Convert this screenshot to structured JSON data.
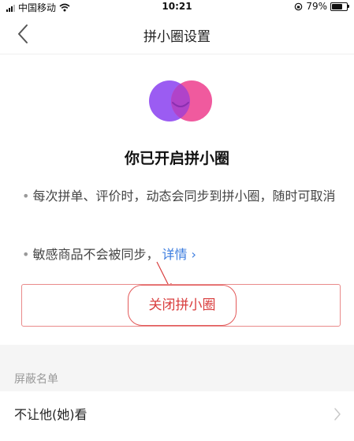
{
  "status_bar": {
    "carrier": "中国移动",
    "time": "10:21",
    "battery_percent": "79%",
    "battery_level": 0.79
  },
  "nav": {
    "title": "拼小圈设置"
  },
  "hero": {
    "title": "你已开启拼小圈",
    "logo_colors": [
      "#9b5cf2",
      "#f05a9e"
    ]
  },
  "descriptions": {
    "line1": "每次拼单、评价时，动态会同步到拼小圈，随时可取消",
    "line2": "敏感商品不会被同步，",
    "details_link": "详情 ›"
  },
  "close_button": {
    "label": "关闭拼小圈",
    "color": "#d93d3d"
  },
  "block_list": {
    "section_label": "屏蔽名单",
    "items": [
      {
        "label": "不让他(她)看"
      }
    ]
  }
}
